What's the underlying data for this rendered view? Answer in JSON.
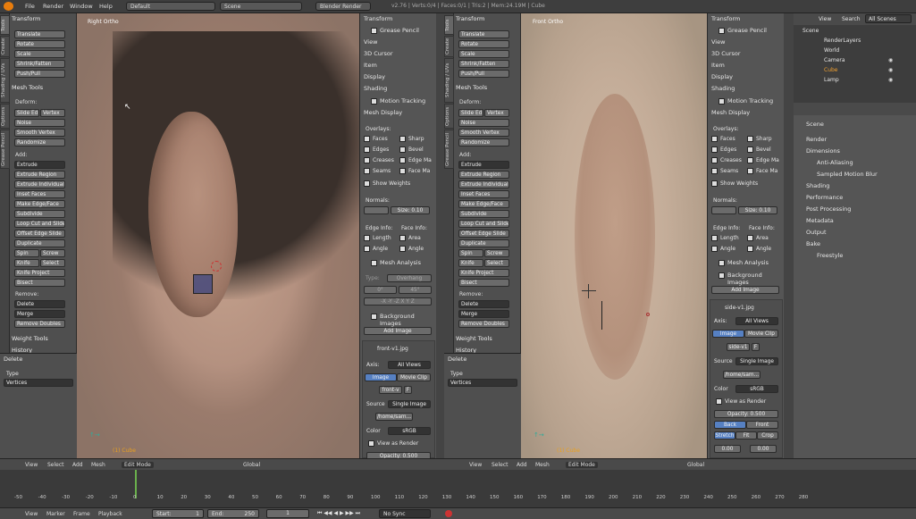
{
  "topbar": {
    "menus": [
      "File",
      "Render",
      "Window",
      "Help"
    ],
    "layout": "Default",
    "scene": "Scene",
    "engine": "Blender Render",
    "stats": "v2.76 | Verts:0/4 | Faces:0/1 | Tris:2 | Mem:24.19M | Cube"
  },
  "vtabs": [
    "Tools",
    "Create",
    "Shading / UVs",
    "Options",
    "Grease Pencil"
  ],
  "tools": {
    "transform_hdr": "Transform",
    "translate": "Translate",
    "rotate": "Rotate",
    "scale": "Scale",
    "shrink": "Shrink/Fatten",
    "pushpull": "Push/Pull",
    "mesh_tools_hdr": "Mesh Tools",
    "deform": "Deform:",
    "slide_ed": "Slide Ed",
    "vertex": "Vertex",
    "noise": "Noise",
    "smooth_vertex": "Smooth Vertex",
    "randomize": "Randomize",
    "add": "Add:",
    "extrude": "Extrude",
    "extrude_region": "Extrude Region",
    "extrude_individual": "Extrude Individual",
    "inset_faces": "Inset Faces",
    "make_edge_face": "Make Edge/Face",
    "subdivide": "Subdivide",
    "loop_cut": "Loop Cut and Slide",
    "offset_edge": "Offset Edge Slide",
    "duplicate": "Duplicate",
    "spin": "Spin",
    "screw": "Screw",
    "knife": "Knife",
    "select": "Select",
    "knife_project": "Knife Project",
    "bisect": "Bisect",
    "remove": "Remove:",
    "delete": "Delete",
    "merge": "Merge",
    "remove_doubles": "Remove Doubles",
    "weight_tools": "Weight Tools",
    "history": "History",
    "op_hdr": "Delete",
    "type_lbl": "Type",
    "type_val": "Vertices"
  },
  "left_view": {
    "label": "Right Ortho",
    "object": "(1) Cube"
  },
  "right_view": {
    "label": "Front Ortho",
    "object": "(1) Cube"
  },
  "npanel": {
    "transform": "Transform",
    "grease_pencil": "Grease Pencil",
    "view": "View",
    "cursor": "3D Cursor",
    "item": "Item",
    "display": "Display",
    "shading": "Shading",
    "motion_tracking": "Motion Tracking",
    "mesh_display": "Mesh Display",
    "overlays": "Overlays:",
    "faces": "Faces",
    "sharp": "Sharp",
    "edges": "Edges",
    "bevel": "Bevel",
    "creases": "Creases",
    "edge_marks": "Edge Ma",
    "seams": "Seams",
    "face_marks": "Face Ma",
    "show_weights": "Show Weights",
    "normals": "Normals:",
    "size": "Size:",
    "size_val": "0.10",
    "edge_info": "Edge Info:",
    "face_info": "Face Info:",
    "length": "Length",
    "area": "Area",
    "angle": "Angle",
    "angle2": "Angle",
    "mesh_analysis": "Mesh Analysis",
    "type": "Type:",
    "overhang": "Overhang",
    "deg0": "0°",
    "deg45": "45°",
    "axes": [
      "-X",
      "-Y",
      "-Z",
      "X",
      "Y",
      "Z"
    ],
    "bg_images": "Background Images",
    "add_image": "Add Image",
    "img1": "front-v1.jpg",
    "img2": "side-v1.jpg",
    "axis": "Axis:",
    "all_views": "All Views",
    "image": "Image",
    "movie_clip": "Movie Clip",
    "img1_short": "front-v",
    "img2_short": "side-v1",
    "f": "F",
    "source": "Source",
    "single_image": "Single Image",
    "path": "/home/sam...",
    "color": "Color",
    "srgb": "sRGB",
    "view_as_render": "View as Render",
    "opacity": "Opacity:",
    "opacity_val": "0.500",
    "back": "Back",
    "front": "Front",
    "stretch": "Stretch",
    "fit": "Fit",
    "crop": "Crop",
    "zero": "0.00"
  },
  "vheader": {
    "view": "View",
    "select": "Select",
    "add": "Add",
    "mesh": "Mesh",
    "mode": "Edit Mode",
    "orient": "Global"
  },
  "outliner": {
    "view": "View",
    "search": "Search",
    "all_scenes": "All Scenes",
    "items": [
      "Scene",
      "RenderLayers",
      "World",
      "Camera",
      "Cube",
      "Lamp"
    ]
  },
  "properties": {
    "scene": "Scene",
    "panels": [
      "Render",
      "Dimensions",
      "Anti-Aliasing",
      "Sampled Motion Blur",
      "Shading",
      "Performance",
      "Post Processing",
      "Metadata",
      "Output",
      "Bake",
      "Freestyle"
    ]
  },
  "timeline": {
    "ticks": [
      "-50",
      "-40",
      "-30",
      "-20",
      "-10",
      "0",
      "10",
      "20",
      "30",
      "40",
      "50",
      "60",
      "70",
      "80",
      "90",
      "100",
      "110",
      "120",
      "130",
      "140",
      "150",
      "160",
      "170",
      "180",
      "190",
      "200",
      "210",
      "220",
      "230",
      "240",
      "250",
      "260",
      "270",
      "280"
    ],
    "view": "View",
    "marker": "Marker",
    "frame": "Frame",
    "playback": "Playback",
    "start_lbl": "Start:",
    "start_val": "1",
    "end_lbl": "End:",
    "end_val": "250",
    "current": "1",
    "sync": "No Sync"
  },
  "colors": {
    "bg": "#393939",
    "panel": "#555555",
    "accent_blue": "#5680c2",
    "active_orange": "#f0a030"
  }
}
